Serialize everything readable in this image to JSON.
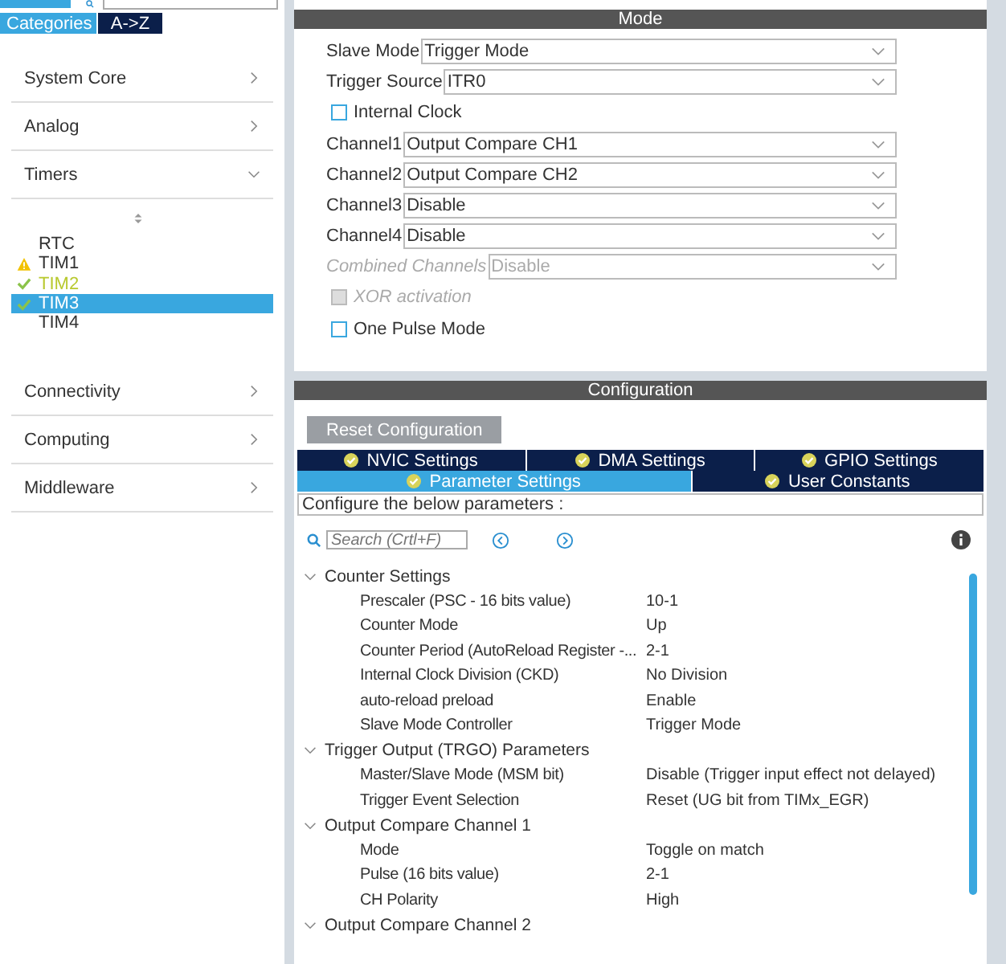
{
  "sidebar": {
    "view_tabs": [
      {
        "label": "Categories",
        "selected": true
      },
      {
        "label": "A->Z",
        "selected": false
      }
    ],
    "categories": [
      {
        "label": "System Core",
        "expanded": false
      },
      {
        "label": "Analog",
        "expanded": false
      },
      {
        "label": "Timers",
        "expanded": true,
        "items": [
          {
            "label": "RTC",
            "warning": false,
            "configured": false,
            "selected": false
          },
          {
            "label": "TIM1",
            "warning": true,
            "configured": false,
            "selected": false
          },
          {
            "label": "TIM2",
            "warning": false,
            "configured": true,
            "selected": false
          },
          {
            "label": "TIM3",
            "warning": false,
            "configured": true,
            "selected": true
          },
          {
            "label": "TIM4",
            "warning": false,
            "configured": false,
            "selected": false
          }
        ]
      },
      {
        "label": "Connectivity",
        "expanded": false
      },
      {
        "label": "Computing",
        "expanded": false
      },
      {
        "label": "Middleware",
        "expanded": false
      }
    ]
  },
  "mode": {
    "title": "Mode",
    "controls": [
      {
        "kind": "select",
        "label": "Slave Mode",
        "value": "Trigger Mode",
        "disabled": false
      },
      {
        "kind": "select",
        "label": "Trigger Source",
        "value": "ITR0",
        "disabled": false
      },
      {
        "kind": "checkbox",
        "label": "Internal Clock",
        "checked": false,
        "disabled": false
      },
      {
        "kind": "select",
        "label": "Channel1",
        "value": "Output Compare CH1",
        "disabled": false
      },
      {
        "kind": "select",
        "label": "Channel2",
        "value": "Output Compare CH2",
        "disabled": false
      },
      {
        "kind": "select",
        "label": "Channel3",
        "value": "Disable",
        "disabled": false
      },
      {
        "kind": "select",
        "label": "Channel4",
        "value": "Disable",
        "disabled": false
      },
      {
        "kind": "select",
        "label": "Combined Channels",
        "value": "Disable",
        "disabled": true
      },
      {
        "kind": "checkbox",
        "label": "XOR activation",
        "checked": false,
        "disabled": true
      },
      {
        "kind": "checkbox",
        "label": "One Pulse Mode",
        "checked": false,
        "disabled": false
      }
    ]
  },
  "configuration": {
    "title": "Configuration",
    "reset_button": "Reset Configuration",
    "tab_rows": [
      [
        {
          "label": "NVIC Settings",
          "selected": false
        },
        {
          "label": "DMA Settings",
          "selected": false
        },
        {
          "label": "GPIO Settings",
          "selected": false
        }
      ],
      [
        {
          "label": "Parameter Settings",
          "selected": true
        },
        {
          "label": "User Constants",
          "selected": false
        }
      ]
    ],
    "hint": "Configure the below parameters :",
    "search": {
      "placeholder": "Search (Crtl+F)"
    },
    "groups": [
      {
        "label": "Counter Settings",
        "expanded": true,
        "children": [
          {
            "name": "Prescaler (PSC - 16 bits value)",
            "value": "10-1"
          },
          {
            "name": "Counter Mode",
            "value": "Up"
          },
          {
            "name": "Counter Period (AutoReload Register -...",
            "value": "2-1"
          },
          {
            "name": "Internal Clock Division (CKD)",
            "value": "No Division"
          },
          {
            "name": "auto-reload preload",
            "value": "Enable"
          },
          {
            "name": "Slave Mode Controller",
            "value": "Trigger Mode"
          }
        ]
      },
      {
        "label": "Trigger Output (TRGO) Parameters",
        "expanded": true,
        "children": [
          {
            "name": "Master/Slave Mode (MSM bit)",
            "value": "Disable (Trigger input effect not delayed)"
          },
          {
            "name": "Trigger Event Selection",
            "value": "Reset (UG bit from TIMx_EGR)"
          }
        ]
      },
      {
        "label": "Output Compare Channel 1",
        "expanded": true,
        "children": [
          {
            "name": "Mode",
            "value": "Toggle on match"
          },
          {
            "name": "Pulse (16 bits value)",
            "value": "2-1"
          },
          {
            "name": "CH Polarity",
            "value": "High"
          }
        ]
      },
      {
        "label": "Output Compare Channel 2",
        "expanded": true
      }
    ]
  }
}
